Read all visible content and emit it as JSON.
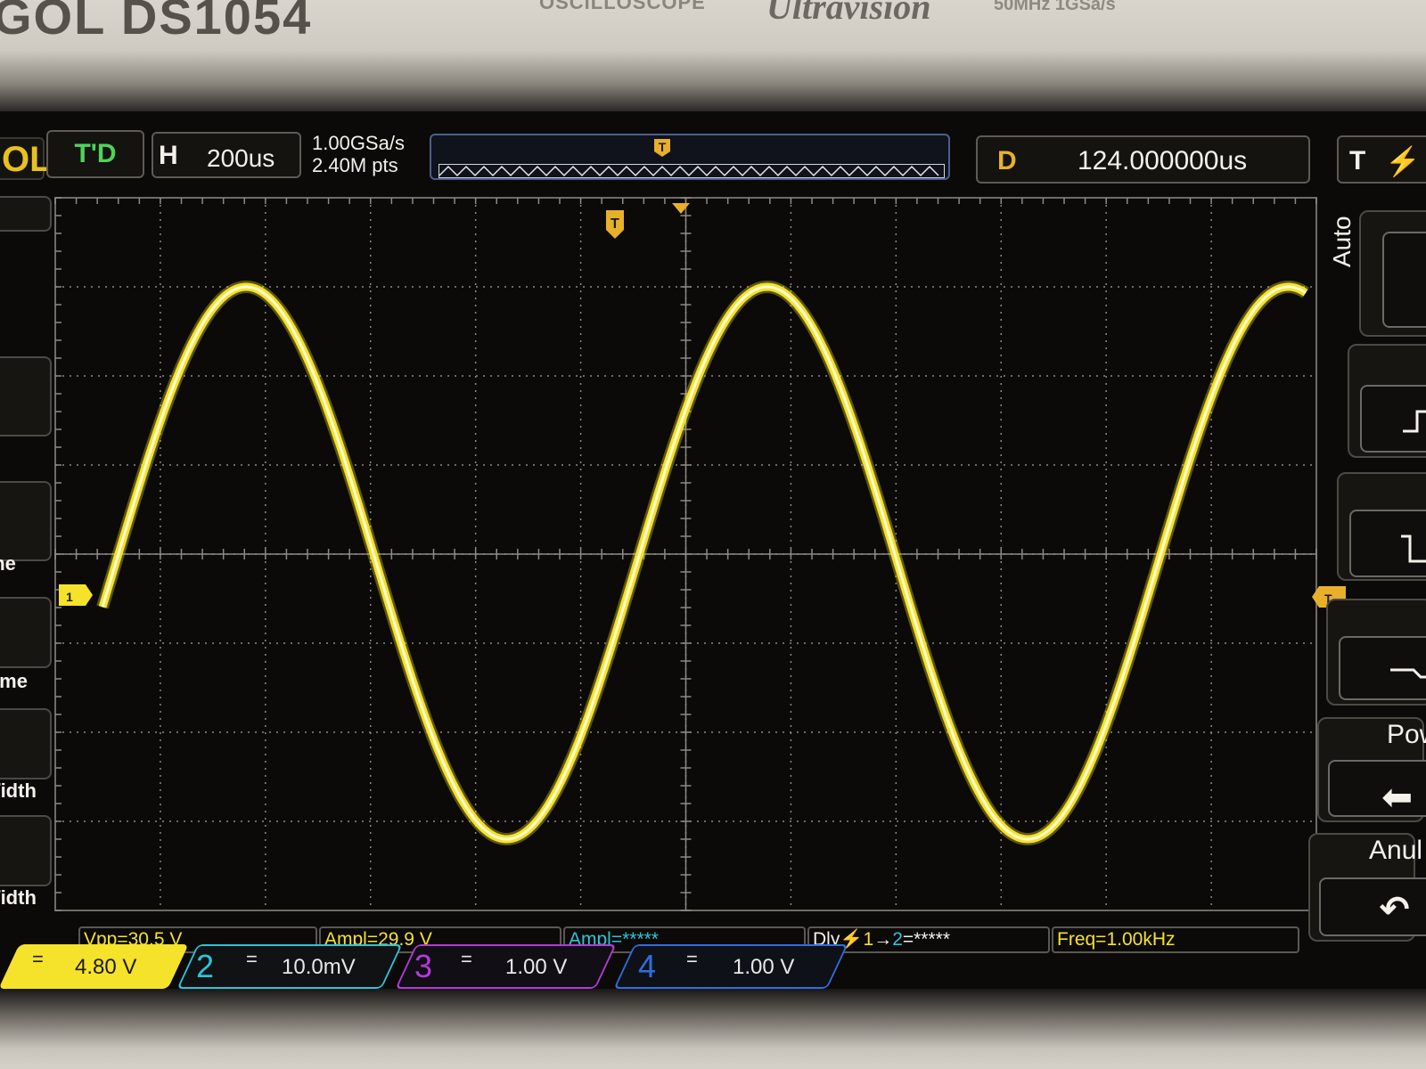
{
  "bezel": {
    "model": "GOL DS1054",
    "osc_label": "OSCILLOSCOPE",
    "series": "Ultravision",
    "spec": "50MHz 1GSa/s"
  },
  "topbar": {
    "brand_fragment": "OL",
    "mode": "T'D",
    "horizontal_letter": "H",
    "timebase": "200us",
    "sample_rate": "1.00GSa/s",
    "memory_depth": "2.40M pts",
    "delay_letter": "D",
    "delay_value": "124.000000us",
    "trigger_letter": "T",
    "trigger_icon": "rising-edge-icon"
  },
  "left_menu": {
    "labels": [
      "ime",
      "Time",
      "Width",
      "Width"
    ]
  },
  "right_menu": {
    "auto_label": "Auto",
    "power_label": "Pow",
    "cancel_label": "Anul"
  },
  "measurements": {
    "vpp": "Vpp=30.5 V",
    "ampl1": "Ampl=29.9 V",
    "ampl2": "Ampl=*****",
    "delay": "Dly",
    "delay_ch1": "1",
    "delay_arrow": "→",
    "delay_ch2": "2",
    "delay_val": "=*****",
    "freq": "Freq=1.00kHz"
  },
  "channels": [
    {
      "num": "1",
      "coupling": "=",
      "scale": "4.80 V",
      "color": "#f5e22a"
    },
    {
      "num": "2",
      "coupling": "=",
      "scale": "10.0mV",
      "color": "#2ec4d8"
    },
    {
      "num": "3",
      "coupling": "=",
      "scale": "1.00 V",
      "color": "#b23cd8"
    },
    {
      "num": "4",
      "coupling": "=",
      "scale": "1.00 V",
      "color": "#2f6ee0"
    }
  ],
  "markers": {
    "trigger_label": "T",
    "level_label": "T",
    "ch1_label": "1"
  },
  "chart_data": {
    "type": "line",
    "signal": "sine",
    "frequency": "1.00kHz",
    "timebase": "200us",
    "volts_per_div": "4.80 V",
    "vpp": "30.5 V",
    "amplitude": "29.9 V",
    "divisions": {
      "horizontal": 12,
      "vertical": 8
    },
    "trace_color": "#f5e22a"
  },
  "colors": {
    "ch1": "#f5e22a",
    "ch2": "#2ec4d8",
    "ch3": "#b23cd8",
    "ch4": "#2f6ee0",
    "trigger": "#e8b02a",
    "grid": "#8c8a84"
  }
}
